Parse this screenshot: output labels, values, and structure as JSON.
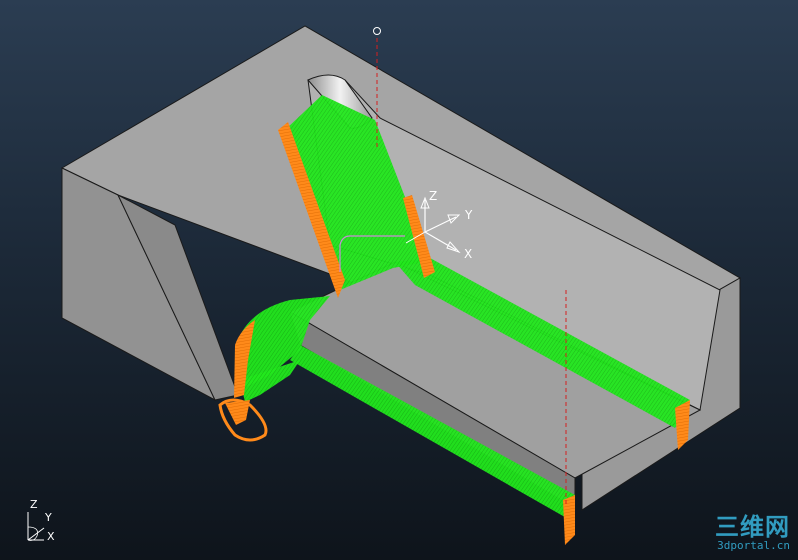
{
  "viewport": {
    "background_top": "#2b3d52",
    "background_bottom": "#0e141b",
    "part_color": "#a9a9a9",
    "toolpath_color": "#22e81d",
    "lead_color": "#ff8a1a",
    "marker_color": "#d42020"
  },
  "csys": {
    "origin_marker": "O",
    "x_label": "X",
    "y_label": "Y",
    "z_label": "Z"
  },
  "triad": {
    "x_label": "X",
    "y_label": "Y",
    "z_label": "Z"
  },
  "watermark": {
    "main": "三维网",
    "sub": "3dportal.cn"
  }
}
